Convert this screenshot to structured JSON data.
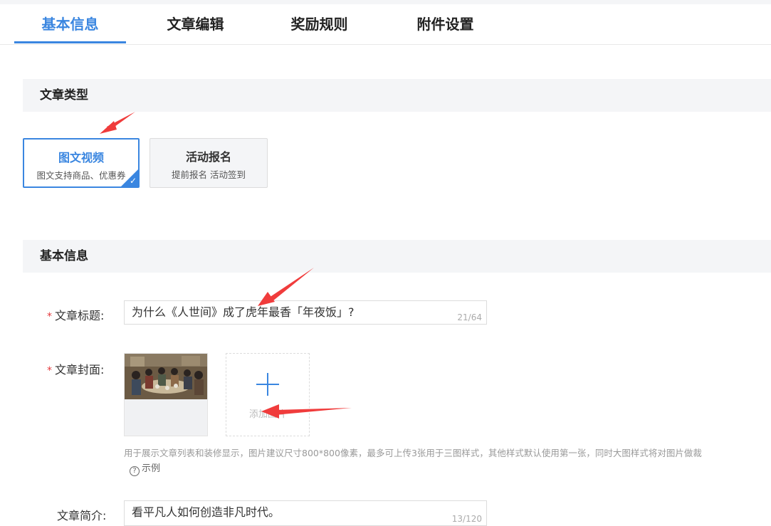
{
  "tabs": [
    {
      "label": "基本信息",
      "active": true
    },
    {
      "label": "文章编辑"
    },
    {
      "label": "奖励规则"
    },
    {
      "label": "附件设置"
    }
  ],
  "sections": {
    "type_title": "文章类型",
    "basic_title": "基本信息"
  },
  "article_types": [
    {
      "title": "图文视频",
      "subtitle": "图文支持商品、优惠券",
      "selected": true
    },
    {
      "title": "活动报名",
      "subtitle": "提前报名 活动签到",
      "selected": false
    }
  ],
  "form": {
    "required_mark": "*",
    "title_label": "文章标题:",
    "title_value": "为什么《人世间》成了虎年最香「年夜饭」?",
    "title_counter": "21/64",
    "cover_label": "文章封面:",
    "upload_label": "添加图片",
    "cover_hint": "用于展示文章列表和装修显示，图片建议尺寸800*800像素，最多可上传3张用于三图样式，其他样式默认使用第一张，同时大图样式将对图片做裁",
    "example_label": "示例",
    "summary_label": "文章简介:",
    "summary_value": "看平凡人如何创造非凡时代。",
    "summary_counter": "13/120"
  },
  "colors": {
    "accent": "#3a86e0",
    "required": "#e4393c",
    "annotation_arrow": "#f03c3c"
  }
}
